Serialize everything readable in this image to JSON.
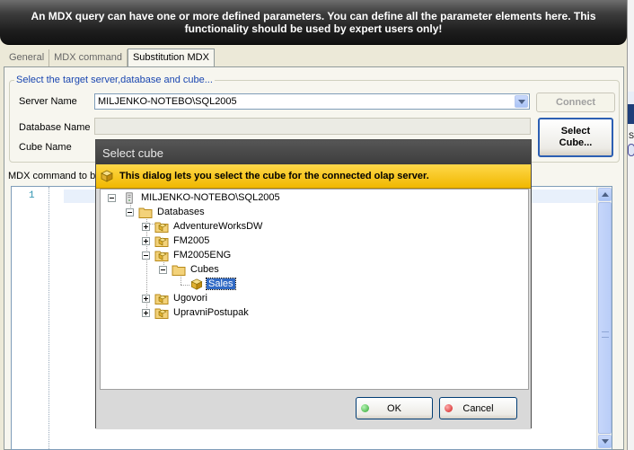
{
  "banner": {
    "line1": "An MDX query can have one or more defined parameters. You can define all the parameter elements here. This",
    "line2": "functionality should be used by expert users only!"
  },
  "tabs": [
    {
      "label": "General",
      "active": false
    },
    {
      "label": "MDX command",
      "active": false
    },
    {
      "label": "Substitution MDX",
      "active": true
    }
  ],
  "target_group": {
    "title": "Select the target server,database and cube...",
    "server_label": "Server Name",
    "server_value": "MILJENKO-NOTEBO\\SQL2005",
    "database_label": "Database Name",
    "database_value": "",
    "cube_label": "Cube Name",
    "connect_label": "Connect",
    "select_cube_line1": "Select",
    "select_cube_line2": "Cube..."
  },
  "editor": {
    "label": "MDX command to be",
    "line_number": "1"
  },
  "dialog": {
    "title": "Select cube",
    "info": "This dialog lets you select the cube for the connected olap server.",
    "tree": {
      "server": "MILJENKO-NOTEBO\\SQL2005",
      "databases_folder": "Databases",
      "databases": [
        "AdventureWorksDW",
        "FM2005",
        "FM2005ENG",
        "Ugovori",
        "UpravniPostupak"
      ],
      "cubes_folder": "Cubes",
      "selected_cube": "Sales"
    },
    "ok_label": "OK",
    "cancel_label": "Cancel"
  },
  "side_strip": {
    "visible_char": "S"
  },
  "colors": {
    "accent_blue": "#1a46b0",
    "selection": "#316ac5",
    "info_bar": "#f0b800",
    "ok_dot": "#2fa52f",
    "cancel_dot": "#d01818"
  }
}
